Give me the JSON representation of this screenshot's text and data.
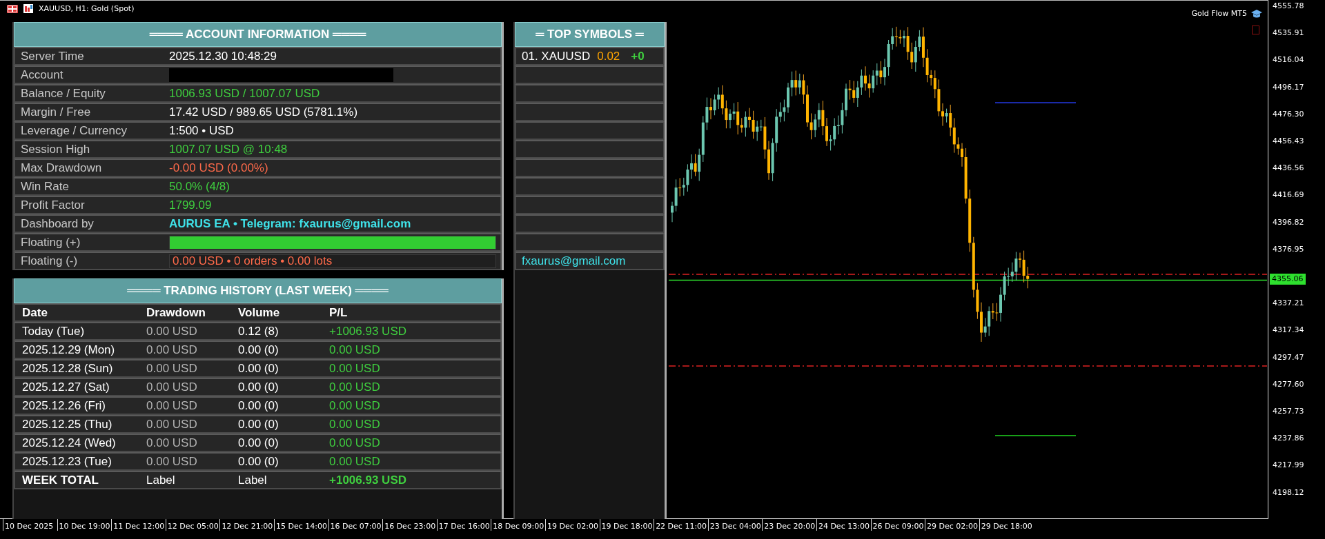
{
  "window": {
    "title": "XAUUSD, H1:  Gold (Spot)",
    "indicator": "Gold Flow MT5"
  },
  "account_panel": {
    "title": "════ ACCOUNT INFORMATION ════",
    "rows": [
      {
        "kind": "neutral",
        "label": "Server Time",
        "value": "2025.12.30 10:48:29"
      },
      {
        "kind": "masked",
        "label": "Account"
      },
      {
        "kind": "positive",
        "label": "Balance / Equity",
        "value": "1006.93 USD / 1007.07 USD"
      },
      {
        "kind": "neutral",
        "label": "Margin / Free",
        "value": "17.42 USD / 989.65 USD  (5781.1%)"
      },
      {
        "kind": "neutral",
        "label": "Leverage / Currency",
        "value": "1:500 • USD"
      },
      {
        "kind": "positive",
        "label": "Session High",
        "value": "1007.07 USD @ 10:48"
      },
      {
        "kind": "negative",
        "label": "Max Drawdown",
        "value": "-0.00 USD (0.00%)"
      },
      {
        "kind": "positive",
        "label": "Win Rate",
        "value": "50.0% (4/8)"
      },
      {
        "kind": "positive",
        "label": "Profit Factor",
        "value": "1799.09"
      },
      {
        "kind": "link",
        "label": "Dashboard by",
        "value": "AURUS EA • Telegram: fxaurus@gmail.com"
      },
      {
        "kind": "meter",
        "label": "Floating (+)",
        "level": 1
      },
      {
        "kind": "meter",
        "label": "Floating (-)",
        "level": 0,
        "value": "0.00 USD • 0 orders • 0.00 lots"
      }
    ]
  },
  "top_symbols": {
    "title": "═ TOP SYMBOLS ═",
    "rows": [
      {
        "kind": "symbol",
        "name": "01. XAUUSD",
        "lots": "0.02",
        "change": "+0"
      },
      {
        "kind": "empty"
      },
      {
        "kind": "empty"
      },
      {
        "kind": "empty"
      },
      {
        "kind": "empty"
      },
      {
        "kind": "empty"
      },
      {
        "kind": "empty"
      },
      {
        "kind": "empty"
      },
      {
        "kind": "empty"
      },
      {
        "kind": "empty"
      },
      {
        "kind": "empty"
      },
      {
        "kind": "contact",
        "text": "fxaurus@gmail.com"
      }
    ]
  },
  "history_panel": {
    "title": "════ TRADING HISTORY (LAST WEEK) ════",
    "columns": [
      "Date",
      "Drawdown",
      "Volume",
      "P/L"
    ],
    "rows": [
      {
        "kind": "day",
        "date": "Today (Tue)",
        "drawdown": "0.00 USD",
        "volume": "0.12 (8)",
        "pl": "+1006.93 USD"
      },
      {
        "kind": "day",
        "date": "2025.12.29 (Mon)",
        "drawdown": "0.00 USD",
        "volume": "0.00 (0)",
        "pl": "0.00 USD"
      },
      {
        "kind": "day",
        "date": "2025.12.28 (Sun)",
        "drawdown": "0.00 USD",
        "volume": "0.00 (0)",
        "pl": "0.00 USD"
      },
      {
        "kind": "day",
        "date": "2025.12.27 (Sat)",
        "drawdown": "0.00 USD",
        "volume": "0.00 (0)",
        "pl": "0.00 USD"
      },
      {
        "kind": "day",
        "date": "2025.12.26 (Fri)",
        "drawdown": "0.00 USD",
        "volume": "0.00 (0)",
        "pl": "0.00 USD"
      },
      {
        "kind": "day",
        "date": "2025.12.25 (Thu)",
        "drawdown": "0.00 USD",
        "volume": "0.00 (0)",
        "pl": "0.00 USD"
      },
      {
        "kind": "day",
        "date": "2025.12.24 (Wed)",
        "drawdown": "0.00 USD",
        "volume": "0.00 (0)",
        "pl": "0.00 USD"
      },
      {
        "kind": "day",
        "date": "2025.12.23 (Tue)",
        "drawdown": "0.00 USD",
        "volume": "0.00 (0)",
        "pl": "0.00 USD"
      },
      {
        "kind": "total",
        "date": "WEEK TOTAL",
        "drawdown": "Label",
        "volume": "Label",
        "pl": "+1006.93 USD"
      }
    ]
  },
  "price_axis": {
    "labels": [
      "4555.78",
      "4535.91",
      "4516.04",
      "4496.17",
      "4476.30",
      "4456.43",
      "4436.56",
      "4416.69",
      "4396.82",
      "4376.95",
      "4337.21",
      "4317.34",
      "4297.47",
      "4277.60",
      "4257.73",
      "4237.86",
      "4217.99",
      "4198.12"
    ],
    "current_price": "4355.06"
  },
  "time_axis": {
    "labels": [
      "10 Dec 2025",
      "10 Dec 19:00",
      "11 Dec 12:00",
      "12 Dec 05:00",
      "12 Dec 21:00",
      "15 Dec 14:00",
      "16 Dec 07:00",
      "16 Dec 23:00",
      "17 Dec 16:00",
      "18 Dec 09:00",
      "19 Dec 02:00",
      "19 Dec 18:00",
      "22 Dec 11:00",
      "23 Dec 04:00",
      "23 Dec 20:00",
      "24 Dec 13:00",
      "26 Dec 09:00",
      "29 Dec 02:00",
      "29 Dec 18:00"
    ]
  }
}
